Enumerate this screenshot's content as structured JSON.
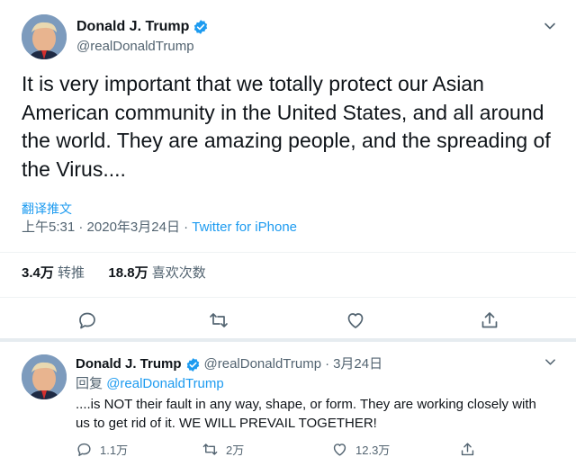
{
  "main_tweet": {
    "display_name": "Donald J. Trump",
    "handle": "@realDonaldTrump",
    "text": "It is very important that we totally protect our Asian American community in the United States, and all around the world. They are amazing people, and the spreading of the Virus....",
    "translate_label": "翻译推文",
    "time": "上午5:31",
    "date": "2020年3月24日",
    "dot": "·",
    "source": "Twitter for iPhone",
    "retweets_count": "3.4万",
    "retweets_label": "转推",
    "likes_count": "18.8万",
    "likes_label": "喜欢次数"
  },
  "reply_tweet": {
    "display_name": "Donald J. Trump",
    "handle": "@realDonaldTrump",
    "dot": "·",
    "date": "3月24日",
    "reply_prefix": "回复",
    "reply_mention": "@realDonaldTrump",
    "text": "....is NOT their fault in any way, shape, or form. They are working closely with us to get rid of it. WE WILL PREVAIL TOGETHER!",
    "replies": "1.1万",
    "retweets": "2万",
    "likes": "12.3万"
  },
  "colors": {
    "accent": "#1d9bf0",
    "text": "#0f1419",
    "muted": "#536471"
  }
}
